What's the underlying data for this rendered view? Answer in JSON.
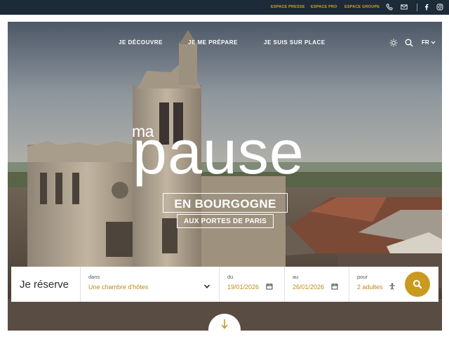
{
  "topbar": {
    "links": [
      "ESPACE PRESSE",
      "ESPACE PRO",
      "ESPACE GROUPE"
    ],
    "icons": [
      "phone-icon",
      "mail-icon",
      "facebook-icon",
      "instagram-icon"
    ]
  },
  "nav": {
    "items": [
      "JE DÉCOUVRE",
      "JE ME PRÉPARE",
      "JE SUIS SUR PLACE"
    ],
    "lang": "FR",
    "icons": [
      "theme-toggle-icon",
      "search-icon",
      "chevron-down-icon"
    ]
  },
  "hero": {
    "line1": "ma",
    "line2": "pause",
    "line3": "EN BOURGOGNE",
    "line4": "AUX PORTES DE PARIS"
  },
  "booking": {
    "title": "Je réserve",
    "where_label": "dans",
    "where_value": "Une chambre d'hôtes",
    "from_label": "du",
    "from_value": "19/01/2026",
    "to_label": "au",
    "to_value": "26/01/2026",
    "guests_label": "pour",
    "guests_value": "2 adultes"
  },
  "colors": {
    "topbar": "#1d2a38",
    "accent": "#c99a1f",
    "accent_text": "#bc8a1d"
  }
}
